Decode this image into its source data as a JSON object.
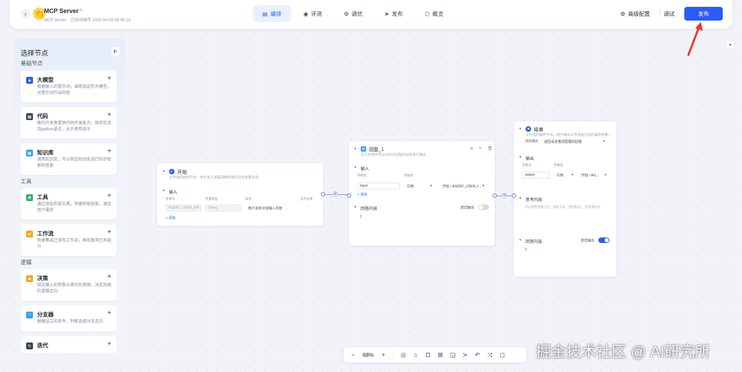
{
  "header": {
    "back_icon": "‹",
    "app_logo_icon": "👏",
    "title": "MCP Server",
    "edit_icon": "✎",
    "subtitle": "MCP Server",
    "saved_text": "已自动保存 2025-04-09 16:45:10",
    "tabs": [
      {
        "label": "编排",
        "icon": "▤",
        "active": true
      },
      {
        "label": "评测",
        "icon": "◉",
        "active": false
      },
      {
        "label": "调优",
        "icon": "⚙",
        "active": false
      },
      {
        "label": "发布",
        "icon": "➤",
        "active": false
      },
      {
        "label": "概览",
        "icon": "⬡",
        "active": false
      }
    ],
    "advanced_icon": "⚙",
    "advanced_label": "高级配置",
    "debug_icon": "⫶",
    "debug_label": "调试",
    "publish_label": "发布",
    "accent_color": "#2a5cf5"
  },
  "left_panel": {
    "title": "选择节点",
    "collapse_icon": "⇇",
    "sections": [
      {
        "label": "基础节点"
      },
      {
        "label": "工具"
      },
      {
        "label": "逻辑"
      }
    ],
    "nodes": [
      {
        "name": "大模型",
        "desc": "根据输入的提示词，调用选定的大模型，对提示词作出回答",
        "icon": "◈",
        "color": "#2a5cf5"
      },
      {
        "name": "代码",
        "desc": "面向开发者提供代码开发能力，目前仅支持python语言，允许使用该节",
        "icon": "▦",
        "color": "#3b4358"
      },
      {
        "name": "知识库",
        "desc": "调用知识库，可以指定知识库进行知识检索和答复",
        "icon": "▣",
        "color": "#3aa3f0"
      },
      {
        "name": "工具",
        "desc": "通过添加外部工具，快捷获取技能，满足用户需求",
        "icon": "✱",
        "color": "#2fb36b"
      },
      {
        "name": "工作流",
        "desc": "快速集成已发布工作流，高效复用已有能力",
        "icon": "⇄",
        "color": "#f5a623"
      },
      {
        "name": "决策",
        "desc": "结合输入的参数与填写的意图，决定后续的逻辑走向",
        "icon": "◆",
        "color": "#f5a623"
      },
      {
        "name": "分支器",
        "desc": "根据设立的条件，判断选择分支走向",
        "icon": "⑂",
        "color": "#3aa3f0"
      },
      {
        "name": "迭代",
        "desc": "",
        "icon": "↻",
        "color": "#3b4358"
      }
    ],
    "add_icon": "+"
  },
  "start_node": {
    "title": "开始",
    "desc": "工作流的启动节点，用于定义流程调用所需的业务变量信息。",
    "input_label": "输入",
    "col_headers": [
      "变量名",
      "变量类型",
      "描述",
      "是否必要"
    ],
    "row": {
      "var": "AGENT_USER_INP",
      "type": "String",
      "desc": "用户本轮对话输入内容",
      "required": "✓"
    },
    "add_label": "+ 添加"
  },
  "reply_node": {
    "title": "回复_1",
    "desc": "在工作流中可以对中间过程的消息进行输出",
    "input_label": "输入",
    "col_headers": [
      "参数名",
      "参数值"
    ],
    "row": {
      "name": "input",
      "type": "引用",
      "value": "开始 / AGENT_USER_I..."
    },
    "add_label": "+ 添加",
    "reply_label": "回答内容",
    "stream_label": "流式输出",
    "stream_on": false,
    "reply_value": "1",
    "header_icons": "⊕ ✎ 🗑"
  },
  "end_node": {
    "title": "结束",
    "desc": "工作流的最终节点，用于输出工作流运行后的最终结果。",
    "mode_label": "回答模式",
    "mode_value": "返回设定格式配置的回答",
    "output_label": "输出",
    "col_headers": [
      "参数名",
      "参数值"
    ],
    "row": {
      "name": "output",
      "type": "引用",
      "value": "开始 / AG..."
    },
    "thinking_label": "思考内容",
    "thinking_placeholder": "可以使用变量占位，读取方式：{{变量名}}，若变量包含...",
    "reply_label": "回答内容",
    "stream_label": "流式输出",
    "stream_on": true,
    "reply_value": "1"
  },
  "bottom_toolbar": {
    "zoom_out": "−",
    "zoom": "68%",
    "zoom_in": "+",
    "tools": [
      "◎",
      "⌂",
      "⊡",
      "⊞",
      "◲",
      "≻",
      "↶",
      "⤨",
      "◻"
    ]
  },
  "side_tool_icon": "▾",
  "watermark": "掘金技术社区 @ AI研究所"
}
